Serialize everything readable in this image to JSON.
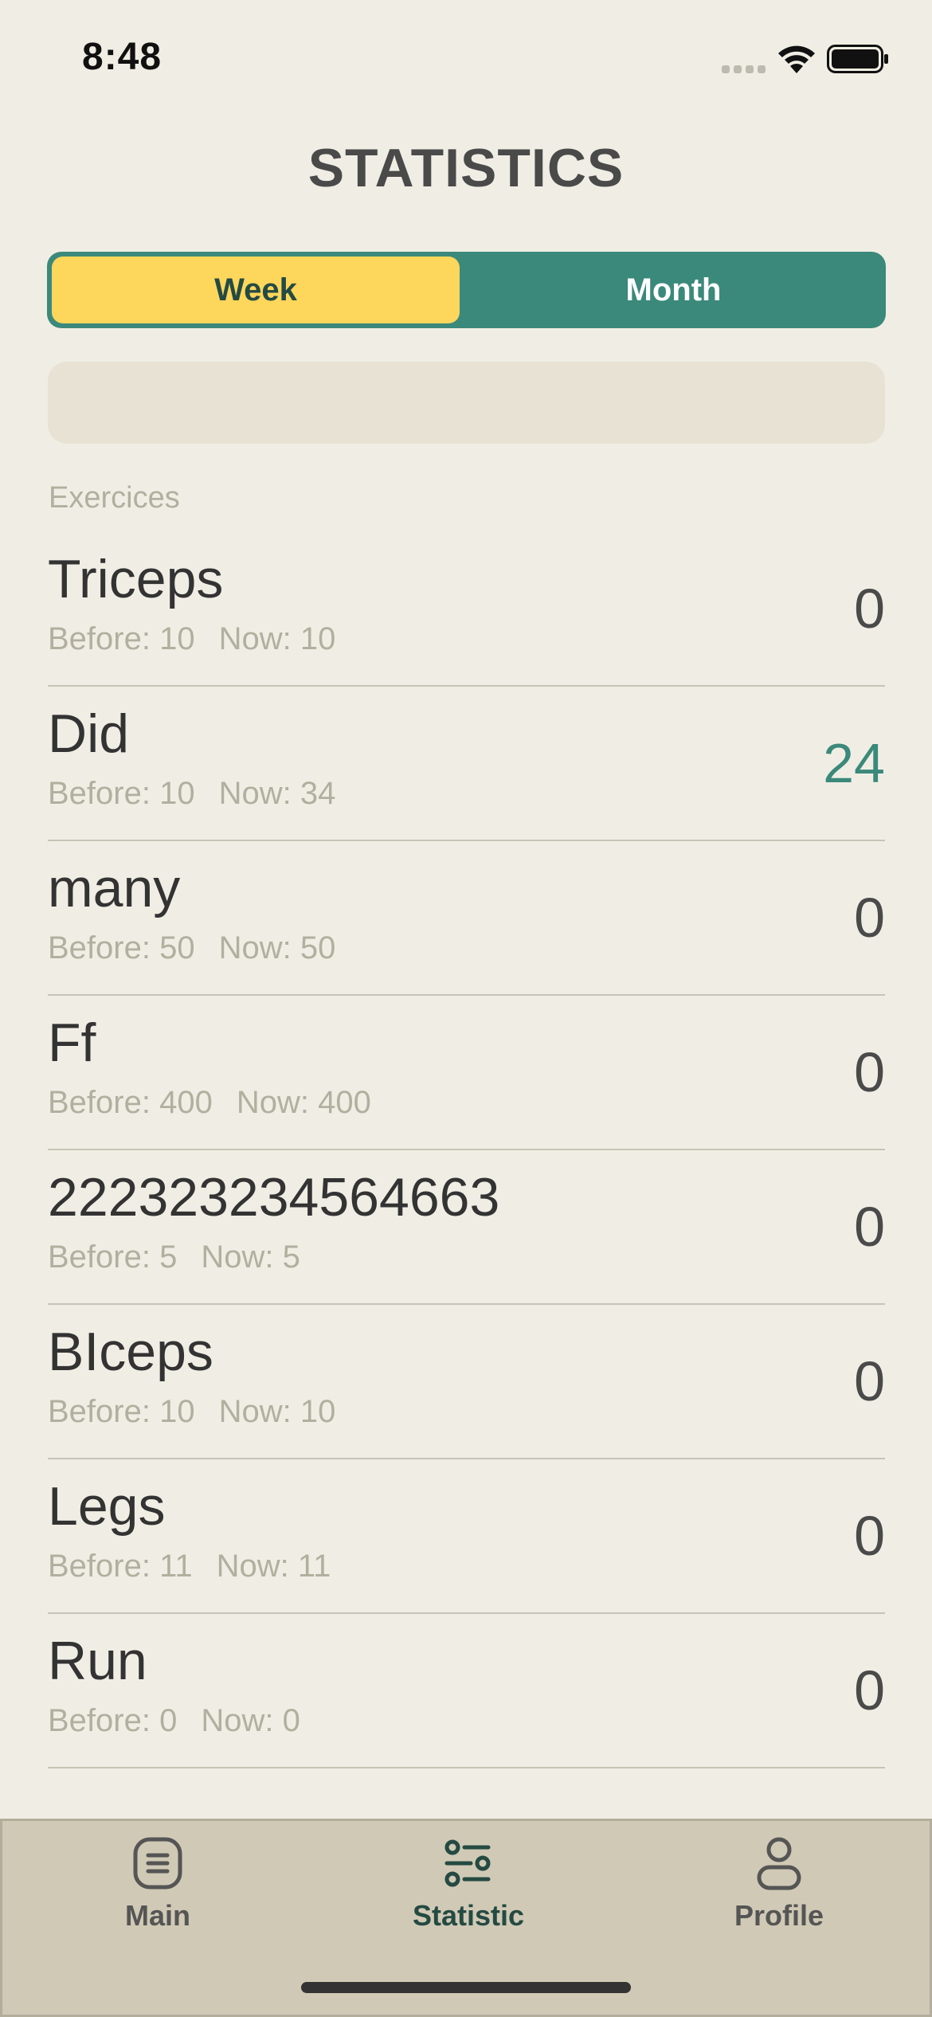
{
  "status_bar": {
    "time": "8:48"
  },
  "header": {
    "title": "STATISTICS"
  },
  "period_toggle": {
    "options": [
      "Week",
      "Month"
    ],
    "selected": "Week"
  },
  "section": {
    "label": "Exercices"
  },
  "exercises": [
    {
      "name": "Triceps",
      "before": "Before: 10",
      "now": "Now: 10",
      "delta": "0",
      "positive": false
    },
    {
      "name": "Did",
      "before": "Before: 10",
      "now": "Now: 34",
      "delta": "24",
      "positive": true
    },
    {
      "name": "many",
      "before": "Before: 50",
      "now": "Now: 50",
      "delta": "0",
      "positive": false
    },
    {
      "name": "Ff",
      "before": "Before: 400",
      "now": "Now: 400",
      "delta": "0",
      "positive": false
    },
    {
      "name": "222323234564663",
      "before": "Before: 5",
      "now": "Now: 5",
      "delta": "0",
      "positive": false
    },
    {
      "name": "BIceps",
      "before": "Before: 10",
      "now": "Now: 10",
      "delta": "0",
      "positive": false
    },
    {
      "name": "Legs",
      "before": "Before: 11",
      "now": "Now: 11",
      "delta": "0",
      "positive": false
    },
    {
      "name": "Run",
      "before": "Before: 0",
      "now": "Now: 0",
      "delta": "0",
      "positive": false
    }
  ],
  "tab_bar": {
    "tabs": [
      {
        "label": "Main",
        "icon": "list-icon"
      },
      {
        "label": "Statistic",
        "icon": "sliders-icon"
      },
      {
        "label": "Profile",
        "icon": "person-icon"
      }
    ],
    "active": "Statistic"
  },
  "colors": {
    "background": "#f0eee4",
    "accent": "#3b897b",
    "highlight": "#fdd65c",
    "tab_bar": "#d0c9b5"
  }
}
